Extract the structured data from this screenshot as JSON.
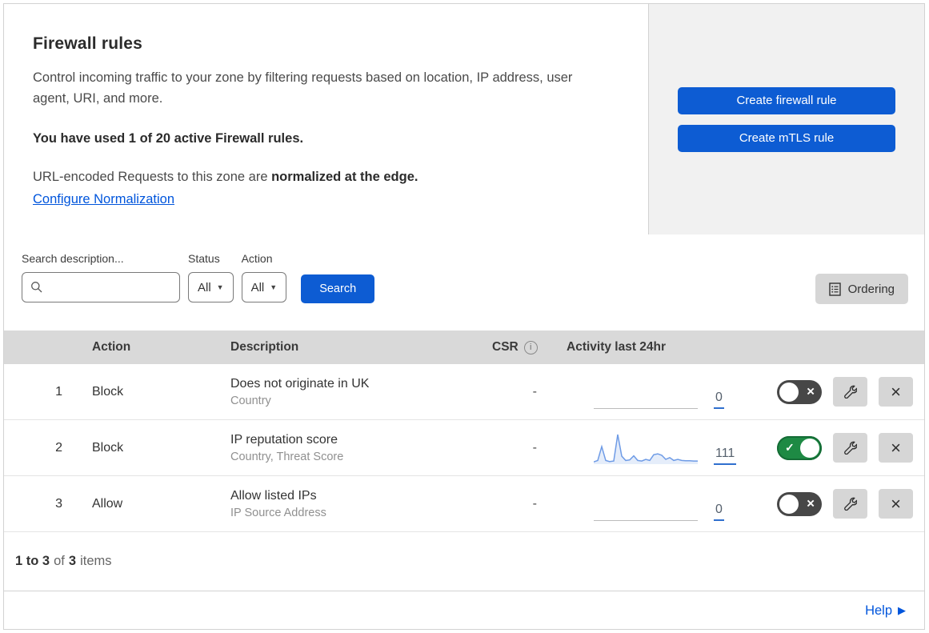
{
  "icons": {
    "caret_down": "▼",
    "check": "✓",
    "cross": "×",
    "info": "i",
    "arrow_right": "▶"
  },
  "header": {
    "title": "Firewall rules",
    "description": "Control incoming traffic to your zone by filtering requests based on location, IP address, user agent, URI, and more.",
    "usage": "You have used 1 of 20 active Firewall rules.",
    "normalization_prefix": "URL-encoded Requests to this zone are ",
    "normalization_bold": "normalized at the edge.",
    "normalization_link": "Configure Normalization",
    "create_firewall_button": "Create firewall rule",
    "create_mtls_button": "Create mTLS rule"
  },
  "filters": {
    "search_label": "Search description...",
    "search_value": "",
    "status_label": "Status",
    "status_value": "All",
    "action_label": "Action",
    "action_value": "All",
    "search_button": "Search",
    "ordering_button": "Ordering"
  },
  "table": {
    "columns": {
      "action": "Action",
      "description": "Description",
      "csr": "CSR",
      "activity": "Activity last 24hr"
    },
    "rows": [
      {
        "number": "1",
        "action": "Block",
        "description": "Does not originate in UK",
        "criteria": "Country",
        "csr": "-",
        "activity_count": "0",
        "enabled": false,
        "sparkline": null
      },
      {
        "number": "2",
        "action": "Block",
        "description": "IP reputation score",
        "criteria": "Country, Threat Score",
        "csr": "-",
        "activity_count": "111",
        "enabled": true,
        "sparkline": [
          5,
          10,
          58,
          10,
          6,
          8,
          100,
          25,
          10,
          12,
          26,
          10,
          8,
          14,
          10,
          30,
          33,
          28,
          14,
          20,
          10,
          14,
          10,
          9,
          9,
          8,
          8
        ]
      },
      {
        "number": "3",
        "action": "Allow",
        "description": "Allow listed IPs",
        "criteria": "IP Source Address",
        "csr": "-",
        "activity_count": "0",
        "enabled": false,
        "sparkline": null
      }
    ]
  },
  "footer": {
    "range": "1 to 3",
    "of_label": "of",
    "total": "3",
    "items_label": "items",
    "help_label": "Help"
  },
  "colors": {
    "accent_blue": "#0d5cd3",
    "link_blue": "#0055dc",
    "toggle_on_green": "#1e8a44",
    "toggle_off_gray": "#474747",
    "sparkline_blue": "#6e9be6"
  }
}
